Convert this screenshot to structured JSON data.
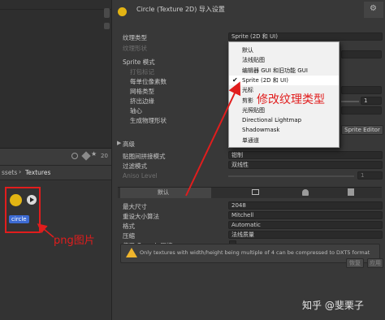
{
  "header": {
    "title": "Circle (Texture 2D) 导入设置"
  },
  "project": {
    "breadcrumb_prefix": "ssets",
    "breadcrumb_folder": "Textures",
    "toolbar_count": "20",
    "asset_name": "circle"
  },
  "settings": {
    "texture_type_label": "纹理类型",
    "texture_type_value": "Sprite (2D 和 UI)",
    "texture_shape_label": "纹理形状",
    "sprite_mode_label": "Sprite 模式",
    "packing_tag_label": "打包标记",
    "pixels_per_unit_label": "每单位像素数",
    "mesh_type_label": "网格类型",
    "extrude_edges_label": "挤出边缘",
    "pivot_label": "轴心",
    "physics_shape_label": "生成物理形状",
    "extrude_value": "1",
    "sprite_editor_label": "Sprite Editor",
    "advanced_label": "高级",
    "wrap_mode_label": "贴图间拼接模式",
    "wrap_mode_value": "钳制",
    "filter_mode_label": "过滤模式",
    "filter_mode_value": "双线性",
    "aniso_label": "Aniso Level",
    "aniso_value": "1"
  },
  "dropdown": {
    "items": [
      {
        "label": "默认",
        "checked": false
      },
      {
        "label": "法线贴图",
        "checked": false
      },
      {
        "label": "编辑器 GUI 和旧功能 GUI",
        "checked": false
      },
      {
        "label": "Sprite (2D 和 UI)",
        "checked": true
      },
      {
        "label": "光标",
        "checked": false
      },
      {
        "label": "剪影",
        "checked": false
      },
      {
        "label": "光照贴图",
        "checked": false
      },
      {
        "label": "Directional Lightmap",
        "checked": false
      },
      {
        "label": "Shadowmask",
        "checked": false
      },
      {
        "label": "单通道",
        "checked": false
      }
    ]
  },
  "platform": {
    "default_tab": "默认",
    "max_size_label": "最大尺寸",
    "max_size_value": "2048",
    "resize_label": "重设大小算法",
    "resize_value": "Mitchell",
    "format_label": "格式",
    "format_value": "Automatic",
    "compression_label": "压缩",
    "compression_value": "法线质量",
    "crunch_label": "使用 Crunch 压缩"
  },
  "warning": {
    "text": "Only textures with width/height being multiple of 4 can be compressed to DXT5 format"
  },
  "buttons": {
    "revert": "恢复",
    "apply": "应用"
  },
  "annotations": {
    "modify_type": "修改纹理类型",
    "png_image": "png图片"
  },
  "watermark": "知乎 @斐栗子",
  "colors": {
    "annotation_red": "#e11d1d",
    "selection_blue": "#3d6bd3",
    "icon_yellow": "#e3b414"
  }
}
